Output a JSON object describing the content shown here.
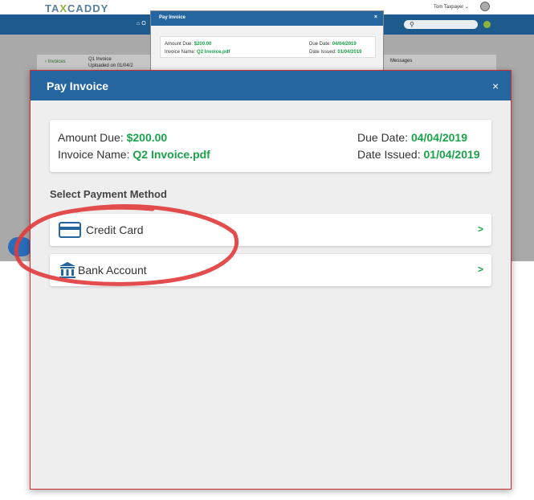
{
  "background": {
    "logo_part1": "TA",
    "logo_x": "X",
    "logo_part2": "CADDY",
    "user_name": "Tom Taxpayer",
    "nav_home": "O",
    "invoices_link": "Invoices",
    "invoice_title": "Q1 Invoice",
    "invoice_uploaded": "Uploaded on 01/04/2",
    "messages": "Messages"
  },
  "mini_modal": {
    "title": "Pay Invoice",
    "close": "×",
    "amount_label": "Amount Due:",
    "amount_value": "$200.00",
    "name_label": "Invoice Name:",
    "name_value": "Q2 Invoice.pdf",
    "due_label": "Due Date:",
    "due_value": "04/04/2019",
    "issued_label": "Date Issued:",
    "issued_value": "01/04/2019"
  },
  "modal": {
    "title": "Pay Invoice",
    "close": "×",
    "amount_label": "Amount Due:",
    "amount_value": "$200.00",
    "name_label": "Invoice Name:",
    "name_value": "Q2 Invoice.pdf",
    "due_label": "Due Date:",
    "due_value": "04/04/2019",
    "issued_label": "Date Issued:",
    "issued_value": "01/04/2019",
    "section_title": "Select Payment Method",
    "options": [
      {
        "label": "Credit Card",
        "icon": "credit-card-icon",
        "chevron": ">"
      },
      {
        "label": "Bank Account",
        "icon": "bank-icon",
        "chevron": ">"
      }
    ]
  },
  "colors": {
    "header_blue": "#2566a1",
    "accent_green": "#1aa34a",
    "annotation_red": "#e03a3a"
  }
}
